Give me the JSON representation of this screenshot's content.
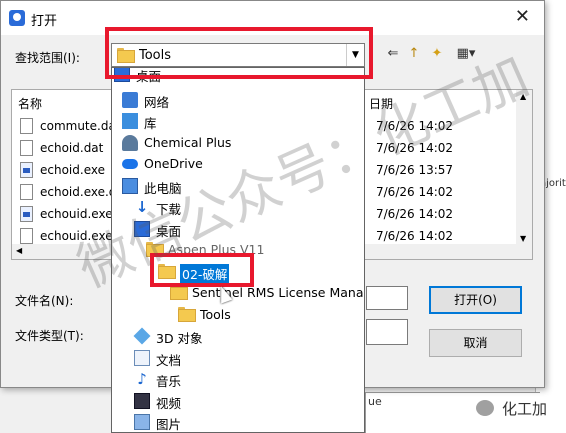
{
  "dialog": {
    "title": "打开",
    "close": "✕"
  },
  "lookin": {
    "label": "查找范围(I):",
    "value": "Tools"
  },
  "toolbar": {
    "back": "⇐",
    "up": "↑",
    "new_folder": "✦",
    "view": "▦▾"
  },
  "filelist": {
    "col_name": "名称",
    "col_date": "日期",
    "rows": [
      {
        "name": "commute.da",
        "date": "7/6/26 14:02",
        "type": "file"
      },
      {
        "name": "echoid.dat",
        "date": "7/6/26 14:02",
        "type": "file"
      },
      {
        "name": "echoid.exe",
        "date": "7/6/26 13:57",
        "type": "exe"
      },
      {
        "name": "echoid.exe.d",
        "date": "7/6/26 14:02",
        "type": "file"
      },
      {
        "name": "echouid.exe",
        "date": "7/6/26 14:02",
        "type": "exe"
      },
      {
        "name": "echouid.exe",
        "date": "7/6/26 14:02",
        "type": "file"
      }
    ]
  },
  "filename": {
    "label": "文件名(N):"
  },
  "filetype": {
    "label": "文件类型(T):"
  },
  "buttons": {
    "open": "打开(O)",
    "cancel": "取消"
  },
  "dropdown": {
    "items": [
      {
        "label": "桌面",
        "icon": "desktop-icon",
        "indent": 0
      },
      {
        "label": "网络",
        "icon": "network-icon",
        "indent": 0
      },
      {
        "label": "库",
        "icon": "library-icon",
        "indent": 0
      },
      {
        "label": "Chemical Plus",
        "icon": "user-icon",
        "indent": 0
      },
      {
        "label": "OneDrive",
        "icon": "onedrive-icon",
        "indent": 0
      },
      {
        "label": "此电脑",
        "icon": "this-pc-icon",
        "indent": 0
      },
      {
        "label": "下载",
        "icon": "download-icon",
        "indent": 1
      },
      {
        "label": "桌面",
        "icon": "desktop-icon",
        "indent": 1
      },
      {
        "label": "Aspen Plus V11",
        "icon": "folder-icon",
        "indent": 2
      },
      {
        "label": "02-破解",
        "icon": "folder-icon",
        "indent": 3
      },
      {
        "label": "Sentinel RMS License Manag",
        "icon": "folder-icon",
        "indent": 4
      },
      {
        "label": "Tools",
        "icon": "folder-icon",
        "indent": 5
      },
      {
        "label": "3D 对象",
        "icon": "3d-objects-icon",
        "indent": 1
      },
      {
        "label": "文档",
        "icon": "documents-icon",
        "indent": 1
      },
      {
        "label": "音乐",
        "icon": "music-icon",
        "indent": 1
      },
      {
        "label": "视频",
        "icon": "video-icon",
        "indent": 1
      },
      {
        "label": "图片",
        "icon": "pictures-icon",
        "indent": 1
      }
    ]
  },
  "background": {
    "side_text": "ajority",
    "bottom_text": "ue"
  },
  "watermark": "微信公众号：化工加",
  "brand": "化工加",
  "colors": {
    "highlight_red": "#e8182d",
    "selection_blue": "#0078d7"
  }
}
